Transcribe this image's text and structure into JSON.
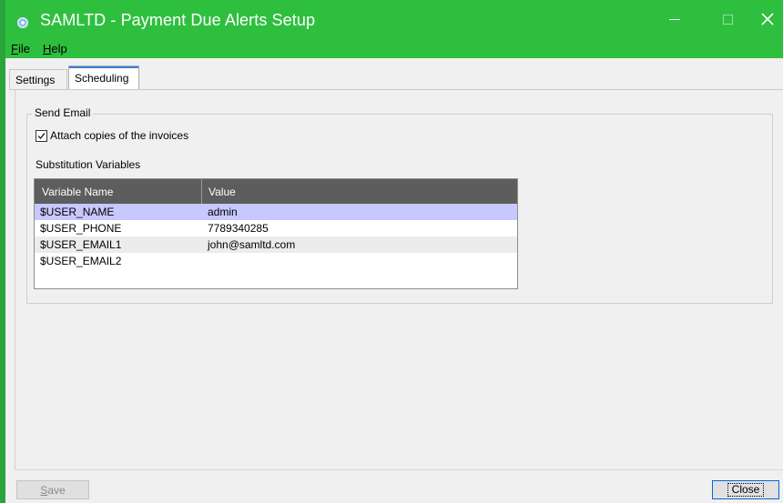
{
  "window": {
    "title": "SAMLTD - Payment Due Alerts Setup",
    "accent_color": "#2fbf3f"
  },
  "menu": [
    {
      "label": "File"
    },
    {
      "label": "Help"
    }
  ],
  "tabs": [
    {
      "label": "Settings",
      "active": false
    },
    {
      "label": "Scheduling",
      "active": true
    }
  ],
  "send_email": {
    "group_label": "Send Email",
    "attach_label": "Attach copies of the invoices",
    "attach_checked": true,
    "subvars_label": "Substitution Variables"
  },
  "grid": {
    "columns": [
      "Variable Name",
      "Value"
    ],
    "rows": [
      {
        "name": "$USER_NAME",
        "value": "admin"
      },
      {
        "name": "$USER_PHONE",
        "value": "7789340285"
      },
      {
        "name": "$USER_EMAIL1",
        "value": "john@samltd.com"
      },
      {
        "name": "$USER_EMAIL2",
        "value": ""
      }
    ]
  },
  "footer": {
    "save_label": "Save",
    "close_label": "Close"
  }
}
